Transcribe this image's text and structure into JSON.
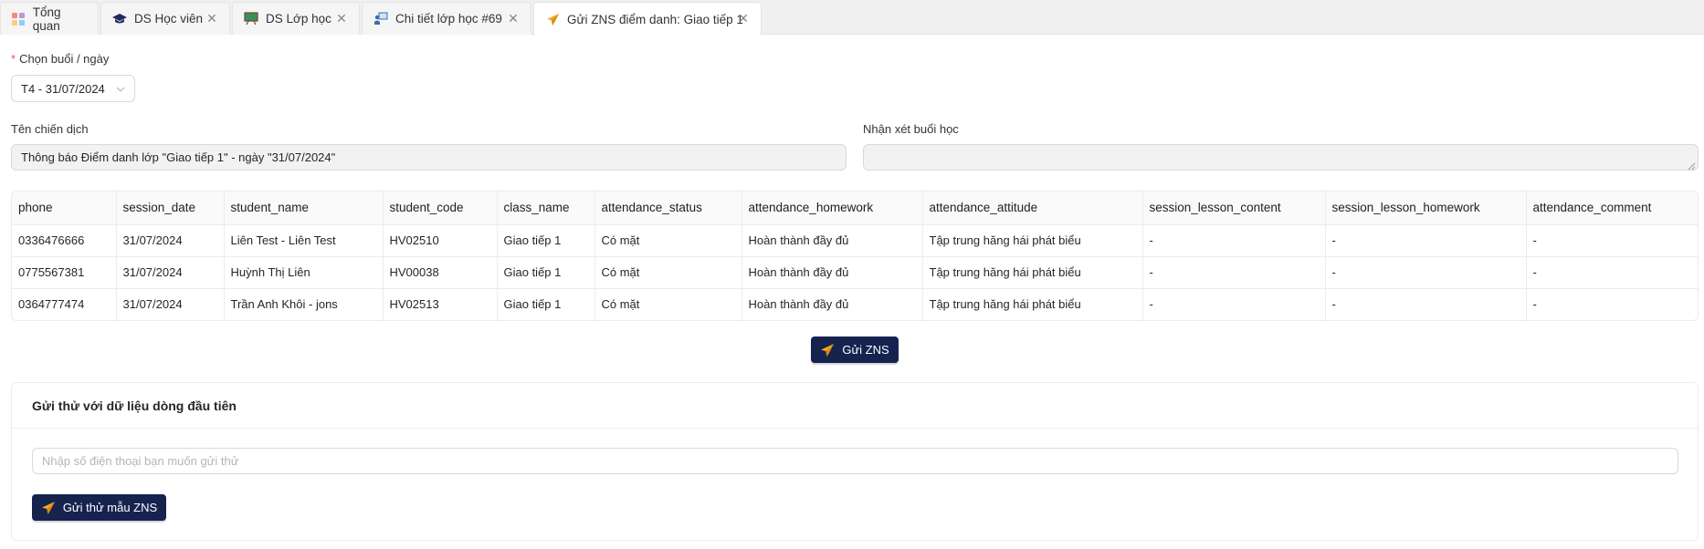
{
  "tabs": [
    {
      "label": "Tổng quan",
      "icon": "dashboard-icon",
      "closable": false
    },
    {
      "label": "DS Học viên",
      "icon": "graduation-cap-icon",
      "closable": true
    },
    {
      "label": "DS Lớp học",
      "icon": "classroom-board-icon",
      "closable": true
    },
    {
      "label": "Chi tiết lớp học #69",
      "icon": "teacher-icon",
      "closable": true
    },
    {
      "label": "Gửi ZNS điểm danh: Giao tiếp 1",
      "icon": "paper-plane-icon",
      "closable": true,
      "active": true
    }
  ],
  "session": {
    "label": "Chọn buổi / ngày",
    "required_mark": "*",
    "selected": "T4 - 31/07/2024"
  },
  "campaign": {
    "label": "Tên chiến dịch",
    "value": "Thông báo Điểm danh lớp \"Giao tiếp 1\" - ngày \"31/07/2024\""
  },
  "comment": {
    "label": "Nhận xét buổi học",
    "value": ""
  },
  "table": {
    "columns": [
      "phone",
      "session_date",
      "student_name",
      "student_code",
      "class_name",
      "attendance_status",
      "attendance_homework",
      "attendance_attitude",
      "session_lesson_content",
      "session_lesson_homework",
      "attendance_comment"
    ],
    "rows": [
      [
        "0336476666",
        "31/07/2024",
        "Liên Test - Liên Test",
        "HV02510",
        "Giao tiếp 1",
        "Có mặt",
        "Hoàn thành đầy đủ",
        "Tập trung hăng hái phát biểu",
        "-",
        "-",
        "-"
      ],
      [
        "0775567381",
        "31/07/2024",
        "Huỳnh Thị Liên",
        "HV00038",
        "Giao tiếp 1",
        "Có mặt",
        "Hoàn thành đầy đủ",
        "Tập trung hăng hái phát biểu",
        "-",
        "-",
        "-"
      ],
      [
        "0364777474",
        "31/07/2024",
        "Trần Anh Khôi - jons",
        "HV02513",
        "Giao tiếp 1",
        "Có mặt",
        "Hoàn thành đầy đủ",
        "Tập trung hăng hái phát biểu",
        "-",
        "-",
        "-"
      ]
    ]
  },
  "send_button": {
    "label": "Gửi ZNS"
  },
  "test_card": {
    "title": "Gửi thử với dữ liệu dòng đầu tiên",
    "phone_placeholder": "Nhập số điện thoại bạn muốn gửi thử",
    "button_label": "Gửi thử mẫu ZNS"
  },
  "colors": {
    "primary_button": "#16234f",
    "plane_icon": "#f5a623",
    "required": "#ff4d4f"
  }
}
